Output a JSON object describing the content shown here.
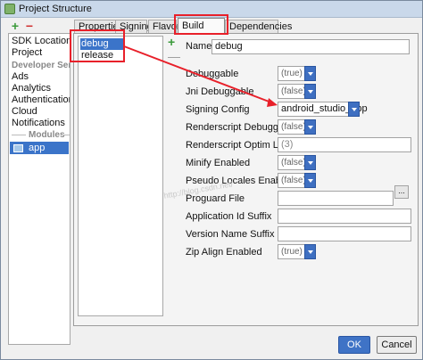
{
  "window": {
    "title": "Project Structure"
  },
  "nav": {
    "add_label": "+",
    "remove_label": "−",
    "items": [
      {
        "label": "SDK Location"
      },
      {
        "label": "Project"
      }
    ],
    "developer_section": "Developer Servic",
    "developer_items": [
      {
        "label": "Ads"
      },
      {
        "label": "Analytics"
      },
      {
        "label": "Authentication"
      },
      {
        "label": "Cloud"
      },
      {
        "label": "Notifications"
      }
    ],
    "modules_section": "Modules",
    "modules": [
      {
        "label": "app",
        "selected": true
      }
    ]
  },
  "tabs": [
    {
      "label": "Properties",
      "active": false
    },
    {
      "label": "Signing",
      "active": false
    },
    {
      "label": "Flavors",
      "active": false
    },
    {
      "label": "Build Types",
      "active": true
    },
    {
      "label": "Dependencies",
      "active": false
    }
  ],
  "build_types": {
    "add_label": "+",
    "remove_label": "—",
    "items": [
      {
        "label": "debug",
        "selected": true
      },
      {
        "label": "release",
        "selected": false
      }
    ]
  },
  "properties": {
    "name": {
      "label": "Name:",
      "value": "debug"
    },
    "debuggable": {
      "label": "Debuggable",
      "value": "(true)"
    },
    "jni_debuggable": {
      "label": "Jni Debuggable",
      "value": "(false)"
    },
    "signing_config": {
      "label": "Signing Config",
      "value": "android_studio_app"
    },
    "renderscript_debuggable": {
      "label": "Renderscript Debuggable",
      "value": "(false)"
    },
    "renderscript_optim_level": {
      "label": "Renderscript Optim Level",
      "value": "(3)"
    },
    "minify_enabled": {
      "label": "Minify Enabled",
      "value": "(false)"
    },
    "pseudo_locales_enabled": {
      "label": "Pseudo Locales Enabled",
      "value": "(false)"
    },
    "proguard_file": {
      "label": "Proguard File",
      "value": "",
      "browse_label": "..."
    },
    "application_id_suffix": {
      "label": "Application Id Suffix",
      "value": ""
    },
    "version_name_suffix": {
      "label": "Version Name Suffix",
      "value": ""
    },
    "zip_align_enabled": {
      "label": "Zip Align Enabled",
      "value": "(true)"
    }
  },
  "buttons": {
    "ok": "OK",
    "cancel": "Cancel"
  },
  "watermark": "http://blog.csdn.net/",
  "colors": {
    "accent": "#3b74c9",
    "annotation": "#e8202a"
  }
}
